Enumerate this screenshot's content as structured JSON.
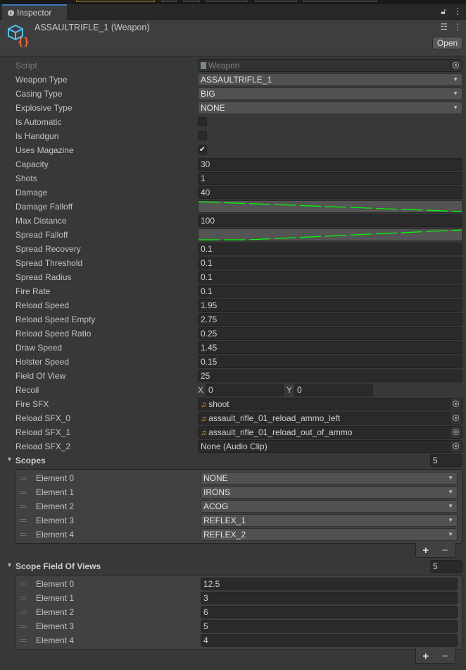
{
  "window": {
    "tab_label": "Inspector",
    "title": "ASSAULTRIFLE_1 (Weapon)",
    "open_button": "Open"
  },
  "colors": {
    "accent": "#3a79bb",
    "curve": "#00ff00",
    "audio_icon": "#f3b315"
  },
  "fields": [
    {
      "label": "Script",
      "type": "object",
      "value": "Weapon",
      "icon": "script-icon",
      "disabled": true
    },
    {
      "label": "Weapon Type",
      "type": "dropdown",
      "value": "ASSAULTRIFLE_1"
    },
    {
      "label": "Casing Type",
      "type": "dropdown",
      "value": "BIG"
    },
    {
      "label": "Explosive Type",
      "type": "dropdown",
      "value": "NONE"
    },
    {
      "label": "Is Automatic",
      "type": "checkbox",
      "checked": false
    },
    {
      "label": "Is Handgun",
      "type": "checkbox",
      "checked": false
    },
    {
      "label": "Uses Magazine",
      "type": "checkbox",
      "checked": true
    },
    {
      "label": "Capacity",
      "type": "text",
      "value": "30"
    },
    {
      "label": "Shots",
      "type": "text",
      "value": "1"
    },
    {
      "label": "Damage",
      "type": "text",
      "value": "40"
    },
    {
      "label": "Damage Falloff",
      "type": "curve",
      "points": [
        [
          0,
          1
        ],
        [
          1,
          0
        ]
      ]
    },
    {
      "label": "Max Distance",
      "type": "text",
      "value": "100"
    },
    {
      "label": "Spread Falloff",
      "type": "curve",
      "points": [
        [
          0,
          0
        ],
        [
          0.19,
          0
        ],
        [
          1,
          1
        ]
      ]
    },
    {
      "label": "Spread Recovery",
      "type": "text",
      "value": "0.1"
    },
    {
      "label": "Spread Threshold",
      "type": "text",
      "value": "0.1"
    },
    {
      "label": "Spread Radius",
      "type": "text",
      "value": "0.1"
    },
    {
      "label": "Fire Rate",
      "type": "text",
      "value": "0.1"
    },
    {
      "label": "Reload Speed",
      "type": "text",
      "value": "1.95"
    },
    {
      "label": "Reload Speed Empty",
      "type": "text",
      "value": "2.75"
    },
    {
      "label": "Reload Speed Ratio",
      "type": "text",
      "value": "0.25"
    },
    {
      "label": "Draw Speed",
      "type": "text",
      "value": "1.45"
    },
    {
      "label": "Holster Speed",
      "type": "text",
      "value": "0.15"
    },
    {
      "label": "Field Of View",
      "type": "text",
      "value": "25"
    },
    {
      "label": "Recoil",
      "type": "vector2",
      "x_label": "X",
      "x": "0",
      "y_label": "Y",
      "y": "0"
    },
    {
      "label": "Fire SFX",
      "type": "object",
      "value": "shoot",
      "icon": "audio-clip-icon"
    },
    {
      "label": "Reload SFX_0",
      "type": "object",
      "value": "assault_rifle_01_reload_ammo_left",
      "icon": "audio-clip-icon"
    },
    {
      "label": "Reload SFX_1",
      "type": "object",
      "value": "assault_rifle_01_reload_out_of_ammo",
      "icon": "audio-clip-icon"
    },
    {
      "label": "Reload SFX_2",
      "type": "object",
      "value": "None (Audio Clip)"
    }
  ],
  "lists": [
    {
      "name": "Scopes",
      "count": "5",
      "kind": "dropdown",
      "items": [
        {
          "label": "Element 0",
          "value": "NONE"
        },
        {
          "label": "Element 1",
          "value": "IRONS"
        },
        {
          "label": "Element 2",
          "value": "ACOG"
        },
        {
          "label": "Element 3",
          "value": "REFLEX_1"
        },
        {
          "label": "Element 4",
          "value": "REFLEX_2"
        }
      ],
      "add": "+",
      "remove": "−"
    },
    {
      "name": "Scope Field Of Views",
      "count": "5",
      "kind": "text",
      "items": [
        {
          "label": "Element 0",
          "value": "12.5"
        },
        {
          "label": "Element 1",
          "value": "3"
        },
        {
          "label": "Element 2",
          "value": "6"
        },
        {
          "label": "Element 3",
          "value": "5"
        },
        {
          "label": "Element 4",
          "value": "4"
        }
      ],
      "add": "+",
      "remove": "−"
    }
  ]
}
